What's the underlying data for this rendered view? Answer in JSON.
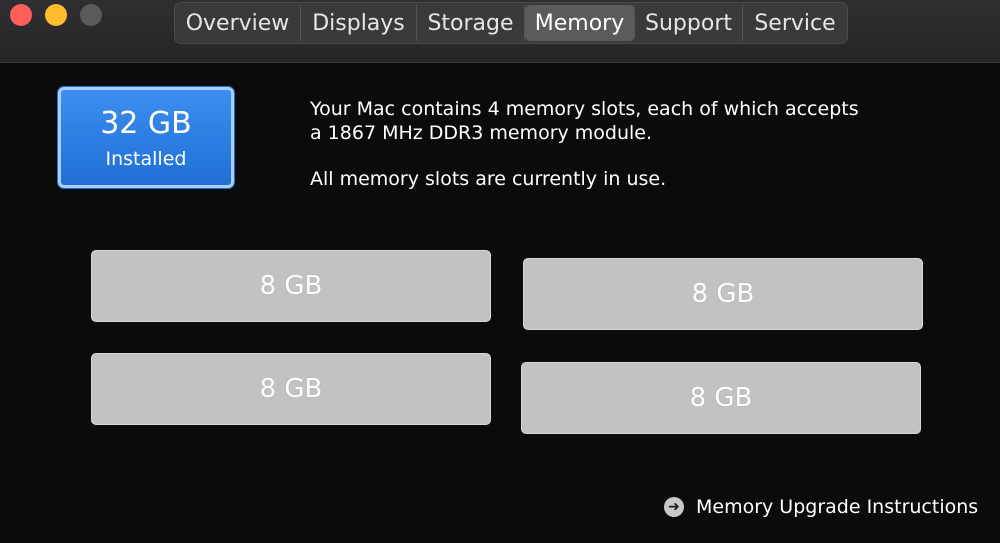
{
  "window": {
    "traffic_lights": [
      "close",
      "minimize",
      "zoom"
    ]
  },
  "tabs": [
    {
      "label": "Overview",
      "active": false
    },
    {
      "label": "Displays",
      "active": false
    },
    {
      "label": "Storage",
      "active": false
    },
    {
      "label": "Memory",
      "active": true
    },
    {
      "label": "Support",
      "active": false
    },
    {
      "label": "Service",
      "active": false
    }
  ],
  "memory": {
    "installed_size": "32 GB",
    "installed_label": "Installed",
    "info_line1": "Your Mac contains 4 memory slots, each of which accepts",
    "info_line2": "a 1867 MHz DDR3 memory module.",
    "info_line3": "All memory slots are currently in use.",
    "slots": [
      "8 GB",
      "8 GB",
      "8 GB",
      "8 GB"
    ],
    "upgrade_link": "Memory Upgrade Instructions",
    "upgrade_icon": "arrow-right-circle-icon"
  },
  "colors": {
    "accent_blue": "#2a7de1",
    "close_red": "#ff5f57",
    "minimize_yellow": "#febc2e",
    "slot_gray": "#c2c2c4"
  }
}
